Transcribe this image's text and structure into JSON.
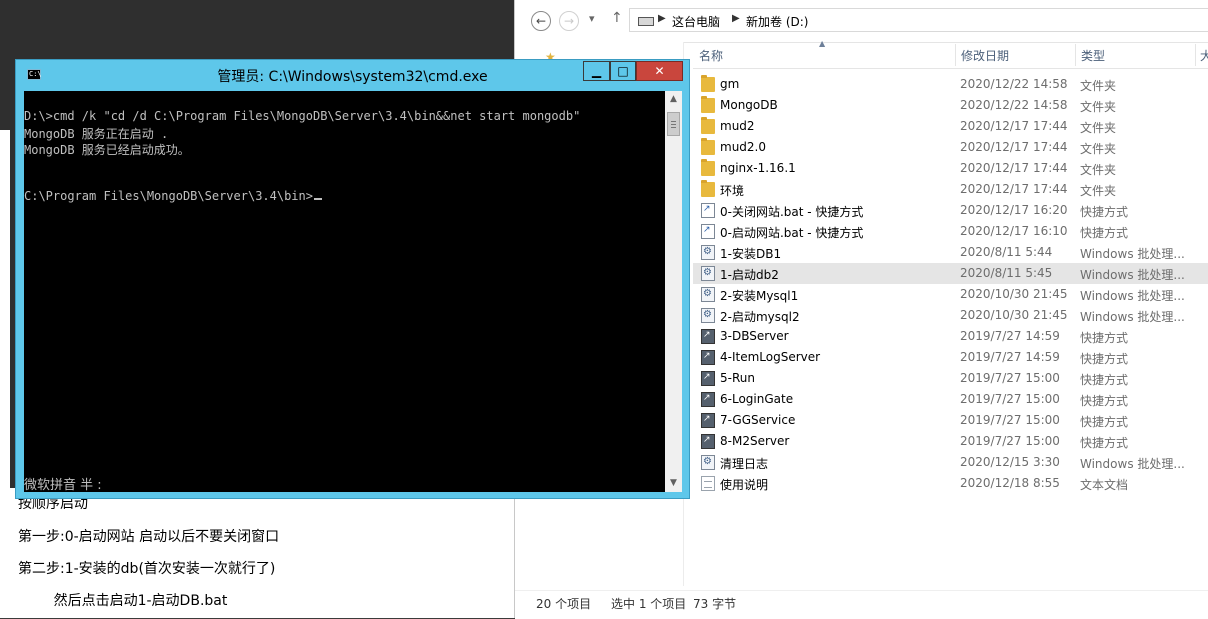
{
  "notepad": {
    "lines": [
      "按顺序启动",
      "第一步:0-启动网站 启动以后不要关闭窗口",
      "第二步:1-安装的db(首次安装一次就行了)",
      "        然后点击启动1-启动DB.bat"
    ]
  },
  "explorer": {
    "breadcrumb": [
      "这台电脑",
      "新加卷 (D:)"
    ],
    "columns": {
      "name": "名称",
      "date": "修改日期",
      "type": "类型",
      "size": "大"
    },
    "files": [
      {
        "name": "gm",
        "date": "2020/12/22 14:58",
        "type": "文件夹",
        "icon": "folder-icon"
      },
      {
        "name": "MongoDB",
        "date": "2020/12/22 14:58",
        "type": "文件夹",
        "icon": "folder-icon"
      },
      {
        "name": "mud2",
        "date": "2020/12/17 17:44",
        "type": "文件夹",
        "icon": "folder-icon"
      },
      {
        "name": "mud2.0",
        "date": "2020/12/17 17:44",
        "type": "文件夹",
        "icon": "folder-icon"
      },
      {
        "name": "nginx-1.16.1",
        "date": "2020/12/17 17:44",
        "type": "文件夹",
        "icon": "folder-icon"
      },
      {
        "name": "环境",
        "date": "2020/12/17 17:44",
        "type": "文件夹",
        "icon": "folder-icon"
      },
      {
        "name": "0-关闭网站.bat - 快捷方式",
        "date": "2020/12/17 16:20",
        "type": "快捷方式",
        "icon": "shortcut-icon"
      },
      {
        "name": "0-启动网站.bat - 快捷方式",
        "date": "2020/12/17 16:10",
        "type": "快捷方式",
        "icon": "shortcut-icon"
      },
      {
        "name": "1-安装DB1",
        "date": "2020/8/11 5:44",
        "type": "Windows 批处理...",
        "icon": "batch-file-icon"
      },
      {
        "name": "1-启动db2",
        "date": "2020/8/11 5:45",
        "type": "Windows 批处理...",
        "icon": "batch-file-icon",
        "selected": true
      },
      {
        "name": "2-安装Mysql1",
        "date": "2020/10/30 21:45",
        "type": "Windows 批处理...",
        "icon": "batch-file-icon"
      },
      {
        "name": "2-启动mysql2",
        "date": "2020/10/30 21:45",
        "type": "Windows 批处理...",
        "icon": "batch-file-icon"
      },
      {
        "name": "3-DBServer",
        "date": "2019/7/27 14:59",
        "type": "快捷方式",
        "icon": "app-shortcut-icon"
      },
      {
        "name": "4-ItemLogServer",
        "date": "2019/7/27 14:59",
        "type": "快捷方式",
        "icon": "app-shortcut-icon"
      },
      {
        "name": "5-Run",
        "date": "2019/7/27 15:00",
        "type": "快捷方式",
        "icon": "app-shortcut-icon"
      },
      {
        "name": "6-LoginGate",
        "date": "2019/7/27 15:00",
        "type": "快捷方式",
        "icon": "app-shortcut-icon"
      },
      {
        "name": "7-GGService",
        "date": "2019/7/27 15:00",
        "type": "快捷方式",
        "icon": "app-shortcut-icon"
      },
      {
        "name": "8-M2Server",
        "date": "2019/7/27 15:00",
        "type": "快捷方式",
        "icon": "app-shortcut-icon"
      },
      {
        "name": "清理日志",
        "date": "2020/12/15 3:30",
        "type": "Windows 批处理...",
        "icon": "batch-file-icon"
      },
      {
        "name": "使用说明",
        "date": "2020/12/18 8:55",
        "type": "文本文档",
        "icon": "text-file-icon"
      }
    ],
    "status": {
      "count": "20 个项目",
      "selection": "选中 1 个项目",
      "size": "73 字节"
    }
  },
  "cmd": {
    "title": "管理员: C:\\Windows\\system32\\cmd.exe",
    "icon_label": "C:\\",
    "lines": [
      "D:\\>cmd /k \"cd /d C:\\Program Files\\MongoDB\\Server\\3.4\\bin&&net start mongodb\"",
      "MongoDB 服务正在启动 .",
      "MongoDB 服务已经启动成功。",
      "",
      "",
      "C:\\Program Files\\MongoDB\\Server\\3.4\\bin>"
    ],
    "ime_status": "微软拼音 半 :"
  },
  "colors": {
    "cmd_frame": "#5ec7ea",
    "close_button": "#c9463d",
    "folder": "#e8b93d",
    "selected_row": "#e5e5e5"
  }
}
